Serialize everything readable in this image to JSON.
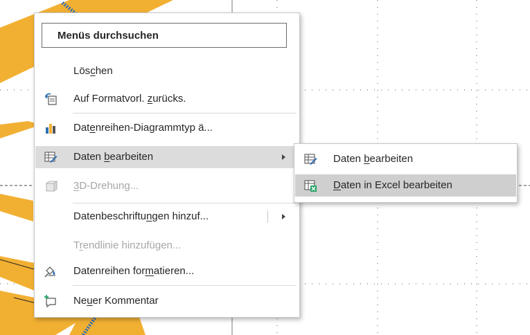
{
  "menu": {
    "search_label": "Menüs durchsuchen",
    "items": [
      {
        "pre": "Lös",
        "key": "c",
        "post": "hen",
        "icon": "none",
        "enabled": true
      },
      {
        "pre": "Auf Formatvorl. ",
        "key": "z",
        "post": "urücks.",
        "icon": "reset-style-icon",
        "enabled": true
      },
      {
        "pre": "Dat",
        "key": "e",
        "post": "nreihen-Diagrammtyp ä...",
        "icon": "bar-chart-icon",
        "enabled": true
      },
      {
        "pre": "Daten ",
        "key": "b",
        "post": "earbeiten",
        "icon": "edit-data-icon",
        "enabled": true,
        "submenu": true,
        "highlighted": true
      },
      {
        "pre": "",
        "key": "3",
        "post": "D-Drehung...",
        "icon": "3d-rotation-icon",
        "enabled": false
      },
      {
        "pre": "Datenbeschriftu",
        "key": "n",
        "post": "gen hinzuf...",
        "icon": "none",
        "enabled": true,
        "submenu": true
      },
      {
        "pre": "T",
        "key": "r",
        "post": "endlinie hinzufügen...",
        "icon": "none",
        "enabled": false
      },
      {
        "pre": "Datenreihen for",
        "key": "m",
        "post": "atieren...",
        "icon": "format-series-icon",
        "enabled": true
      },
      {
        "pre": "Ne",
        "key": "u",
        "post": "er Kommentar",
        "icon": "new-comment-icon",
        "enabled": true
      }
    ]
  },
  "submenu": {
    "items": [
      {
        "pre": "Daten ",
        "key": "b",
        "post": "earbeiten",
        "icon": "edit-data-icon"
      },
      {
        "pre": "",
        "key": "D",
        "post": "aten in Excel bearbeiten",
        "icon": "excel-data-icon",
        "highlighted": true
      }
    ]
  },
  "colors": {
    "chart_fill": "#f2b033",
    "accent_blue": "#2f6fb3",
    "excel_green": "#21a366"
  }
}
